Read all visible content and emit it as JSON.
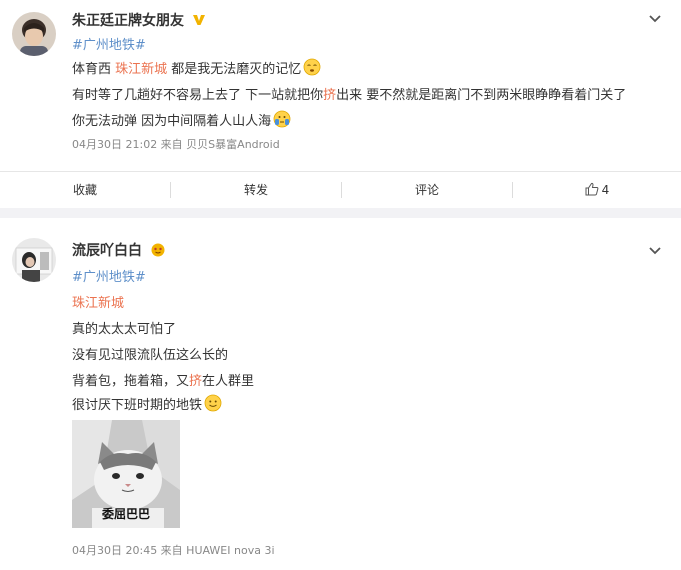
{
  "post1": {
    "username": "朱正廷正牌女朋友",
    "topic": "#广州地铁#",
    "lines": [
      {
        "before": "体育西 ",
        "link": "珠江新城",
        "after": " 都是我无法磨灭的记忆"
      },
      {
        "before": "有时等了几趟好不容易上去了 下一站就把你",
        "link": "挤",
        "after": "出来 要不然就是距离门不到两米眼睁睁看着门关了"
      },
      {
        "before": "你无法动弹 因为中间隔着人山人海",
        "link": "",
        "after": ""
      }
    ],
    "meta": "04月30日 21:02 来自 贝贝S暴富Android",
    "actions": {
      "favorite": "收藏",
      "repost": "转发",
      "comment": "评论",
      "like_count": "4"
    }
  },
  "post2": {
    "username": "流辰吖白白",
    "topic": "#广州地铁#",
    "location": "珠江新城",
    "lines": [
      {
        "before": "真的太太太可怕了",
        "link": "",
        "after": ""
      },
      {
        "before": "没有见过限流队伍这么长的",
        "link": "",
        "after": ""
      },
      {
        "before": "背着包，拖着箱，又",
        "link": "挤",
        "after": "在人群里"
      },
      {
        "before": "很讨厌下班时期的地铁",
        "link": "",
        "after": ""
      }
    ],
    "image_caption": "委屈巴巴",
    "meta": "04月30日 20:45 来自 HUAWEI nova 3i"
  },
  "icons": {
    "verified": "verified-v-icon",
    "emoji_sleepy": "sleepy-face-icon",
    "emoji_crowd": "squeezed-face-icon",
    "emoji_smile": "smile-face-icon",
    "like": "thumbs-up-icon",
    "menu": "chevron-down-icon"
  },
  "colors": {
    "link": "#eb7350",
    "topic": "#5e8fc9",
    "meta": "#888888",
    "verified": "#f2b300"
  }
}
